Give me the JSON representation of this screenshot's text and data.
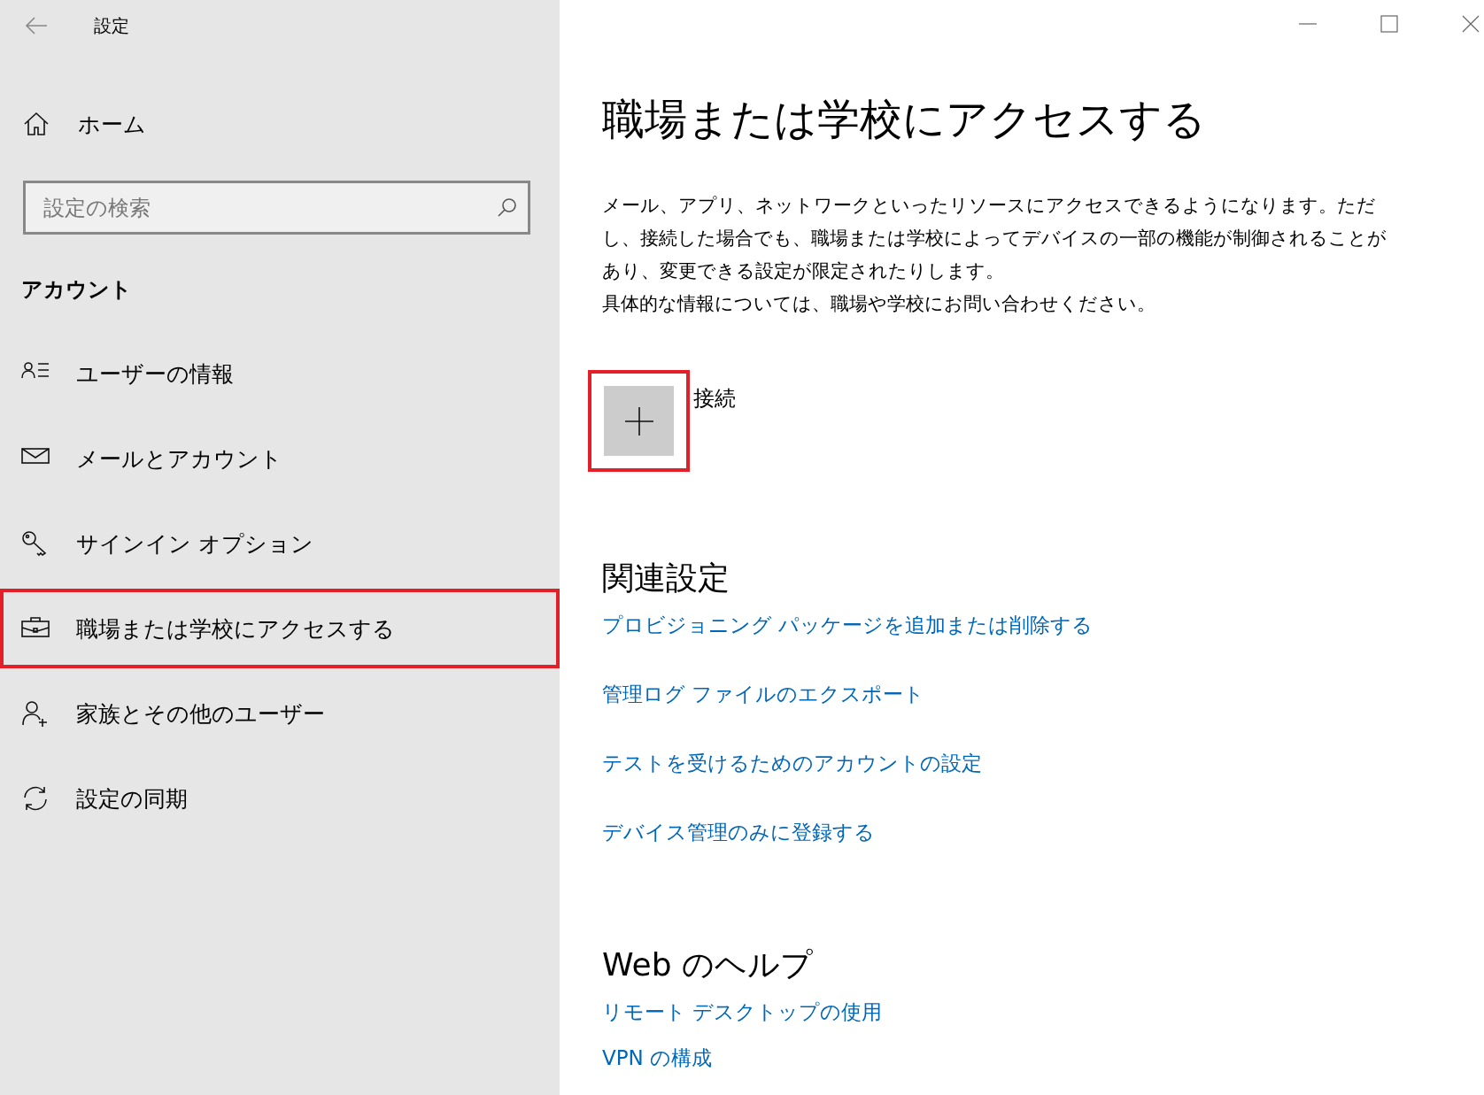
{
  "window": {
    "title": "設定"
  },
  "sidebar": {
    "home": "ホーム",
    "search": {
      "placeholder": "設定の検索"
    },
    "section": "アカウント",
    "items": [
      {
        "label": "ユーザーの情報",
        "highlighted": false
      },
      {
        "label": "メールとアカウント",
        "highlighted": false
      },
      {
        "label": "サインイン オプション",
        "highlighted": false
      },
      {
        "label": "職場または学校にアクセスする",
        "highlighted": true
      },
      {
        "label": "家族とその他のユーザー",
        "highlighted": false
      },
      {
        "label": "設定の同期",
        "highlighted": false
      }
    ]
  },
  "main": {
    "title": "職場または学校にアクセスする",
    "description": [
      "メール、アプリ、ネットワークといったリソースにアクセスできるようになります。ただし、接続した場合でも、職場または学校によってデバイスの一部の機能が制御されることがあり、変更できる設定が限定されたりします。",
      "具体的な情報については、職場や学校にお問い合わせください。"
    ],
    "connect": {
      "label": "接続",
      "highlighted": true
    },
    "related": {
      "heading": "関連設定",
      "links": [
        "プロビジョニング パッケージを追加または削除する",
        "管理ログ ファイルのエクスポート",
        "テストを受けるためのアカウントの設定",
        "デバイス管理のみに登録する"
      ]
    },
    "web_help": {
      "heading": "Web のヘルプ",
      "links": [
        "リモート デスクトップの使用",
        "VPN の構成"
      ]
    }
  }
}
